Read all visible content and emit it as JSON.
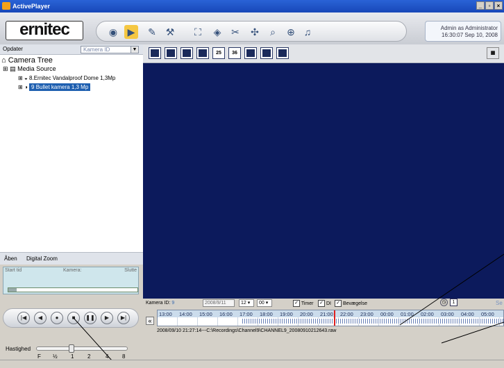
{
  "window": {
    "title": "ActivePlayer"
  },
  "header": {
    "logo": "ernitec",
    "user_line1": "Admin as Administrator",
    "user_line2": "16:30:07 Sep 10, 2008"
  },
  "left": {
    "update_label": "Opdater",
    "combo_value": "Kamera ID",
    "tree_title": "Camera Tree",
    "media_source": "Media Source",
    "cam1": "8.Ernitec Vandalproof Dome 1,3Mp",
    "cam2": "9 Bullet kamera 1,3 Mp"
  },
  "layout_buttons": {
    "b25": "25",
    "b36": "36"
  },
  "tabs": {
    "open": "Åben",
    "digital_zoom": "Digital Zoom"
  },
  "records": {
    "start": "Start tid",
    "camera": "Kamera:",
    "end": "Slutte"
  },
  "speed": {
    "label": "Hastighed",
    "t1": "F",
    "t2": "½",
    "t3": "1",
    "t4": "2",
    "t5": "4",
    "t6": "8"
  },
  "timeline": {
    "camera_label": "Kamera ID:",
    "camera_value": "9",
    "date": "2008/9/11",
    "hour": "12",
    "minute": "00",
    "timer": "Timer",
    "di": "DI",
    "motion": "Bevægelse",
    "search": "Se",
    "collapse": "«",
    "ticks": [
      "13:00",
      "14:00",
      "15:00",
      "16:00",
      "17:00",
      "18:00",
      "19:00",
      "20:00",
      "21:00",
      "22:00",
      "23:00",
      "00:00",
      "01:00",
      "02:00",
      "03:00",
      "04:00",
      "05:00"
    ],
    "file_path": "2008/09/10 21:27:14---C:\\Recordings\\Channel9\\CHANNEL9_20080910212643.raw"
  }
}
